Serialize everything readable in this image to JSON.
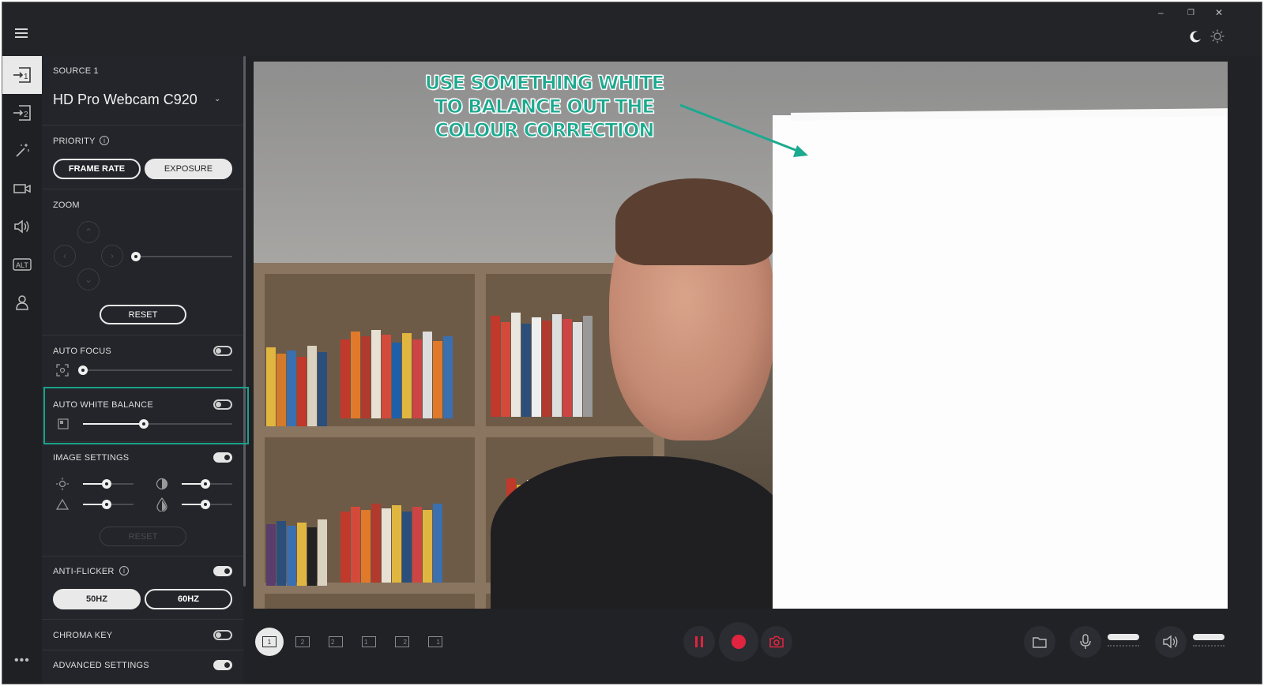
{
  "window": {
    "controls": {
      "minimize": "–",
      "restore": "❐",
      "close": "✕"
    }
  },
  "rail": {
    "items": [
      {
        "name": "source-1",
        "glyph": "→1"
      },
      {
        "name": "source-2",
        "glyph": "→2"
      },
      {
        "name": "effects",
        "glyph": "✧"
      },
      {
        "name": "camera",
        "glyph": "▭"
      },
      {
        "name": "audio",
        "glyph": "🔊"
      },
      {
        "name": "alt",
        "glyph": "ALT"
      },
      {
        "name": "account",
        "glyph": "👤"
      }
    ],
    "more": "•••"
  },
  "panel": {
    "source_label": "SOURCE 1",
    "source_name": "HD Pro Webcam C920",
    "source_caret": "⌄",
    "priority": {
      "label": "PRIORITY",
      "info": "i",
      "options": [
        "FRAME RATE",
        "EXPOSURE"
      ],
      "selected": "EXPOSURE"
    },
    "zoom": {
      "label": "ZOOM",
      "level": 0.0,
      "reset": "RESET"
    },
    "auto_focus": {
      "label": "AUTO FOCUS",
      "enabled": false,
      "value": 0.0
    },
    "auto_white_balance": {
      "label": "AUTO WHITE BALANCE",
      "enabled": false,
      "value": 0.4
    },
    "image_settings": {
      "label": "IMAGE SETTINGS",
      "enabled": true,
      "brightness": 0.5,
      "contrast": 0.5,
      "sharpness": 0.5,
      "saturation": 0.5,
      "reset": "RESET"
    },
    "anti_flicker": {
      "label": "ANTI-FLICKER",
      "info": "i",
      "enabled": true,
      "options": [
        "50HZ",
        "60HZ"
      ],
      "selected": "50HZ"
    },
    "chroma_key": {
      "label": "CHROMA KEY",
      "enabled": false
    },
    "advanced_settings": {
      "label": "ADVANCED SETTINGS",
      "enabled": true
    }
  },
  "preview": {
    "annotation_lines": [
      "USE SOMETHING WHITE",
      "TO BALANCE OUT THE",
      "COLOUR CORRECTION"
    ],
    "annotation_color": "#1ba98f"
  },
  "bottom": {
    "layouts": [
      "1",
      "2",
      "2",
      "1",
      "2",
      "1"
    ],
    "selected_layout": 0
  },
  "colors": {
    "accent": "#1aa28a",
    "record": "#e0243f"
  }
}
